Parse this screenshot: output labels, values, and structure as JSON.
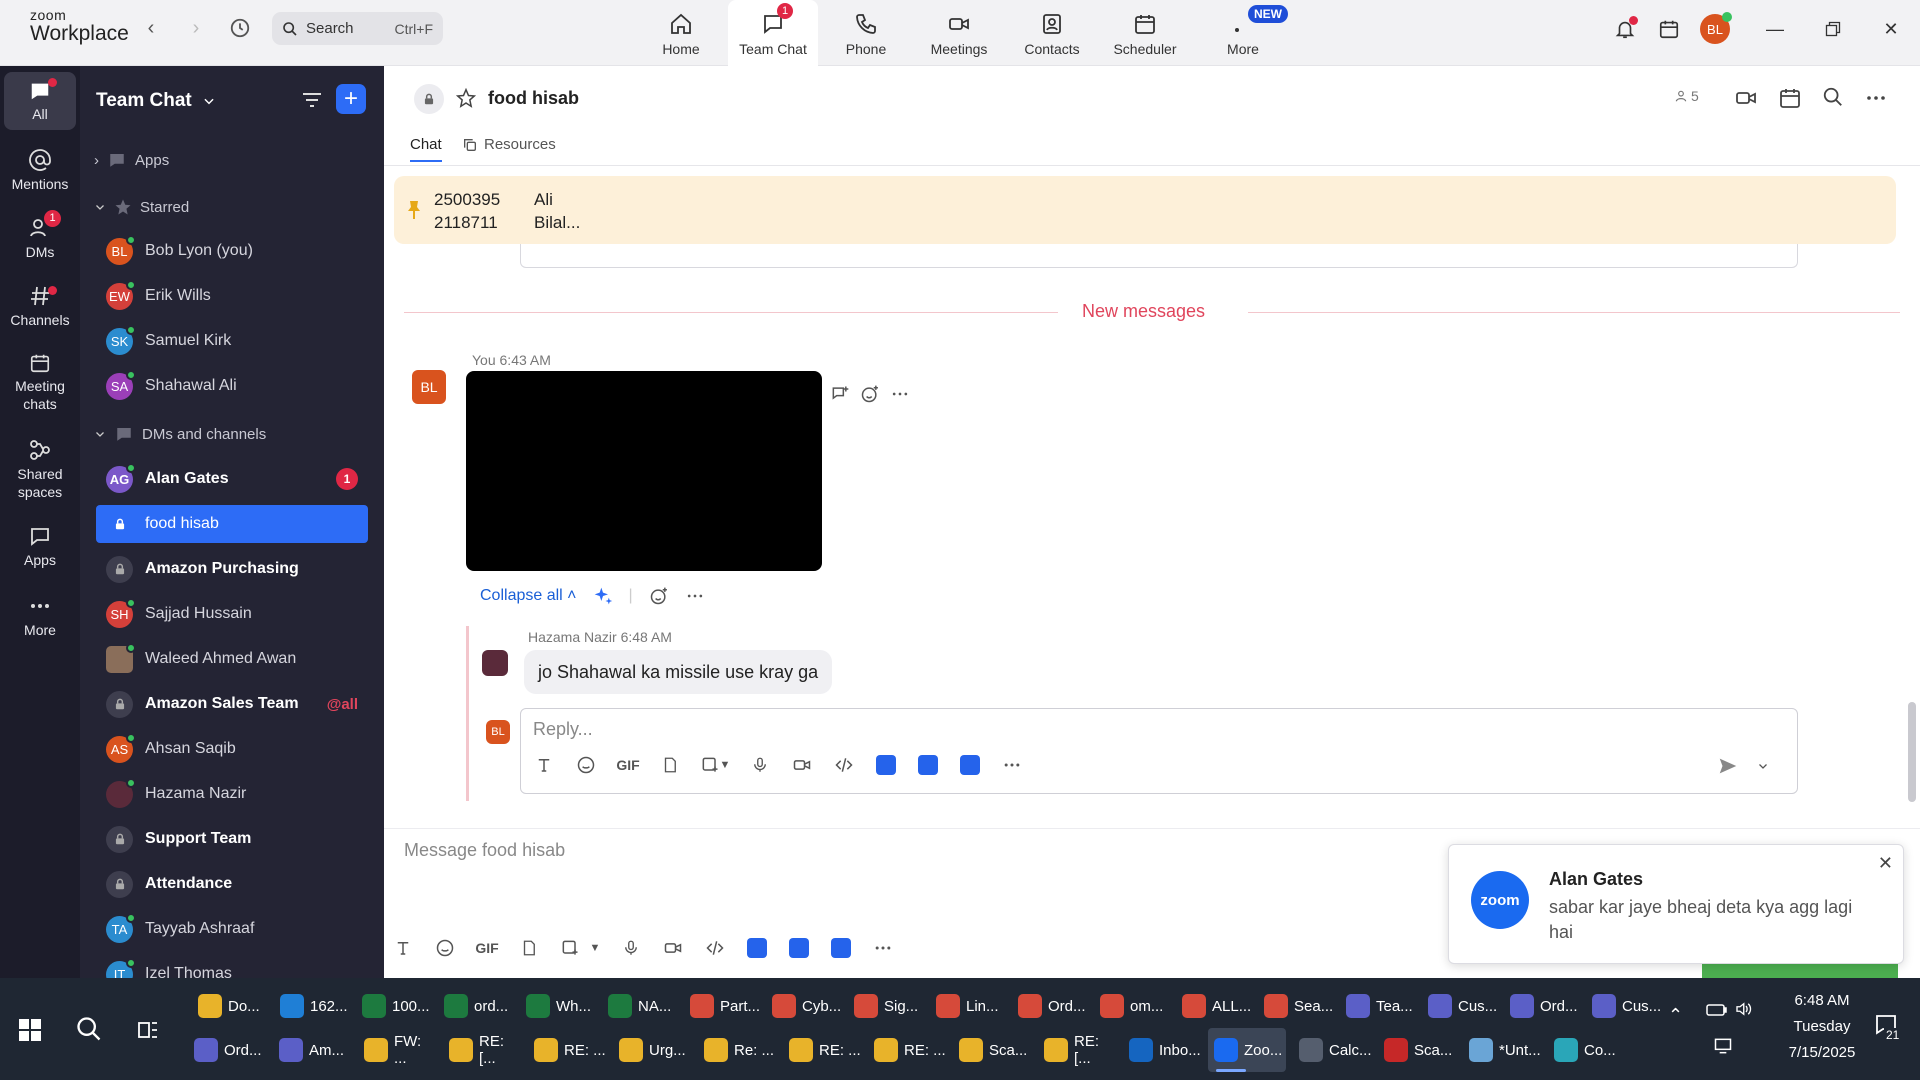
{
  "app": {
    "logo_line1": "zoom",
    "logo_line2": "Workplace"
  },
  "search": {
    "label": "Search",
    "shortcut": "Ctrl+F"
  },
  "top_tabs": [
    {
      "label": "Home",
      "icon": "home-icon"
    },
    {
      "label": "Team Chat",
      "icon": "chat-icon",
      "badge": "1",
      "active": true
    },
    {
      "label": "Phone",
      "icon": "phone-icon"
    },
    {
      "label": "Meetings",
      "icon": "video-icon"
    },
    {
      "label": "Contacts",
      "icon": "contacts-icon"
    },
    {
      "label": "Scheduler",
      "icon": "calendar-icon"
    },
    {
      "label": "More",
      "icon": "more-icon",
      "badge": "NEW"
    }
  ],
  "user": {
    "initials": "BL",
    "avatar_color": "#d9531e"
  },
  "rail": [
    {
      "label": "All",
      "active": true
    },
    {
      "label": "Mentions"
    },
    {
      "label": "DMs",
      "badge": "1"
    },
    {
      "label": "Channels"
    },
    {
      "label": "Meeting chats"
    },
    {
      "label": "Shared spaces"
    },
    {
      "label": "Apps"
    },
    {
      "label": "More"
    }
  ],
  "sidebar": {
    "title": "Team Chat",
    "sections": {
      "apps": "Apps",
      "starred": "Starred",
      "dms": "DMs and channels"
    },
    "starred": [
      {
        "initials": "BL",
        "name": "Bob Lyon (you)",
        "color": "#d9531e"
      },
      {
        "initials": "EW",
        "name": "Erik Wills",
        "color": "#d4403a"
      },
      {
        "initials": "SK",
        "name": "Samuel Kirk",
        "color": "#2b8ccf"
      },
      {
        "initials": "SA",
        "name": "Shahawal Ali",
        "color": "#9b3fb8"
      }
    ],
    "dms": [
      {
        "initials": "AG",
        "name": "Alan Gates",
        "color": "#7b58c9",
        "bold": true,
        "count": "1"
      },
      {
        "name": "food hisab",
        "channel": true,
        "selected": true
      },
      {
        "name": "Amazon Purchasing",
        "channel": true,
        "bold": true
      },
      {
        "initials": "SH",
        "name": "Sajjad Hussain",
        "color": "#d4403a"
      },
      {
        "initials": "",
        "name": "Waleed Ahmed Awan",
        "color": "#8a6e5a"
      },
      {
        "name": "Amazon Sales Team",
        "channel": true,
        "bold": true,
        "tag": "@all"
      },
      {
        "initials": "AS",
        "name": "Ahsan Saqib",
        "color": "#d9531e"
      },
      {
        "initials": "",
        "name": "Hazama Nazir",
        "color": "#5a2a3a"
      },
      {
        "name": "Support Team",
        "channel": true,
        "bold": true
      },
      {
        "name": "Attendance",
        "channel": true,
        "bold": true
      },
      {
        "initials": "TA",
        "name": "Tayyab Ashraaf",
        "color": "#2b8ccf"
      },
      {
        "initials": "IT",
        "name": "Izel Thomas",
        "color": "#2b8ccf"
      }
    ]
  },
  "channel": {
    "name": "food hisab",
    "member_count": "5",
    "tabs": [
      "Chat",
      "Resources"
    ],
    "pinned": {
      "line1_num": "2500395",
      "line2_num": "2118711",
      "line1_name": "Ali",
      "line2_name": "Bilal..."
    },
    "new_messages_label": "New messages",
    "message": {
      "author": "You",
      "time": "6:43 AM",
      "avatar": "BL"
    },
    "collapse_all": "Collapse all",
    "reply": {
      "author": "Hazama Nazir",
      "time": "6:48 AM",
      "text": "jo Shahawal ka missile use kray ga"
    },
    "reply_placeholder": "Reply...",
    "composer_placeholder": "Message food hisab",
    "gif_label": "GIF"
  },
  "notification": {
    "logo_text": "zoom",
    "title": "Alan Gates",
    "body": "sabar kar jaye bheaj deta kya agg lagi hai"
  },
  "taskbar": {
    "row1": [
      {
        "label": "Do...",
        "color": "#e8b32a"
      },
      {
        "label": "162...",
        "color": "#1f7fd6"
      },
      {
        "label": "100...",
        "color": "#1d7a3f"
      },
      {
        "label": "ord...",
        "color": "#1d7a3f"
      },
      {
        "label": "Wh...",
        "color": "#1d7a3f"
      },
      {
        "label": "NA...",
        "color": "#1d7a3f"
      },
      {
        "label": "Part...",
        "color": "#d64a3a"
      },
      {
        "label": "Cyb...",
        "color": "#d64a3a"
      },
      {
        "label": "Sig...",
        "color": "#d64a3a"
      },
      {
        "label": "Lin...",
        "color": "#d64a3a"
      },
      {
        "label": "Ord...",
        "color": "#d64a3a"
      },
      {
        "label": "om...",
        "color": "#d64a3a"
      },
      {
        "label": "ALL...",
        "color": "#d64a3a"
      },
      {
        "label": "Sea...",
        "color": "#d64a3a"
      },
      {
        "label": "Tea...",
        "color": "#5b5fc7"
      },
      {
        "label": "Cus...",
        "color": "#5b5fc7"
      },
      {
        "label": "Ord...",
        "color": "#5b5fc7"
      },
      {
        "label": "Cus...",
        "color": "#5b5fc7"
      }
    ],
    "row2": [
      {
        "label": "Ord...",
        "color": "#5b5fc7"
      },
      {
        "label": "Am...",
        "color": "#5b5fc7"
      },
      {
        "label": "FW: ...",
        "color": "#e8b32a"
      },
      {
        "label": "RE: [...",
        "color": "#e8b32a"
      },
      {
        "label": "RE: ...",
        "color": "#e8b32a"
      },
      {
        "label": "Urg...",
        "color": "#e8b32a"
      },
      {
        "label": "Re: ...",
        "color": "#e8b32a"
      },
      {
        "label": "RE: ...",
        "color": "#e8b32a"
      },
      {
        "label": "RE: ...",
        "color": "#e8b32a"
      },
      {
        "label": "Sca...",
        "color": "#e8b32a"
      },
      {
        "label": "RE: [...",
        "color": "#e8b32a"
      },
      {
        "label": "Inbo...",
        "color": "#1565c0"
      },
      {
        "label": "Zoo...",
        "color": "#1a6af0",
        "active": true
      },
      {
        "label": "Calc...",
        "color": "#555e6e"
      },
      {
        "label": "Sca...",
        "color": "#c62828"
      },
      {
        "label": "*Unt...",
        "color": "#6aa5d6"
      },
      {
        "label": "Co...",
        "color": "#2aa6b8"
      }
    ],
    "clock": {
      "time": "6:48 AM",
      "day": "Tuesday",
      "date": "7/15/2025"
    },
    "notification_count": "21"
  }
}
